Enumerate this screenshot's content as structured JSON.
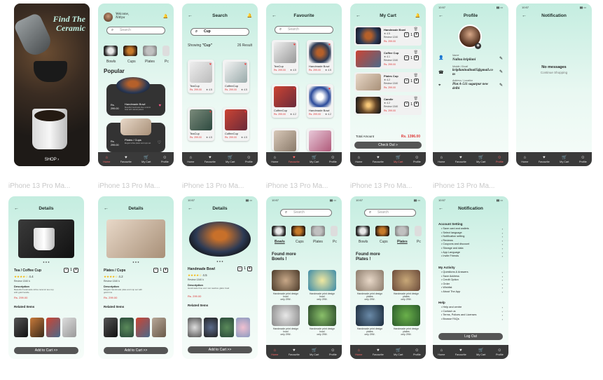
{
  "frame_label": "iPhone 13 Pro Ma...",
  "splash": {
    "title_line1": "Find The",
    "title_line2": "Ceramic",
    "cta": "SHOP"
  },
  "home": {
    "welcome": "Welcome,",
    "user": "Nithya",
    "search_placeholder": "Search",
    "section": "Popular",
    "cat1": "Bowls",
    "cat2": "Cups",
    "cat3": "Plates",
    "cat4": "Pc",
    "card1": {
      "price": "Rs. 299.00",
      "name": "Handmade Bowl",
      "desc": "Beautiful handmade blue ceramic bowl with natural pattern"
    },
    "card2": {
      "price": "Rs. 299.00",
      "name": "Plates / Cups",
      "desc": "Elegant white plates and cups set"
    }
  },
  "nav": {
    "home": "Home",
    "favourite": "Favourite",
    "cart": "My Cart",
    "profile": "Profile"
  },
  "search_screen": {
    "title": "Search",
    "query": "Cup",
    "showing": "Showing",
    "showing_q": "\"Cup\"",
    "results": "26 Result",
    "items": [
      {
        "name": "TeaCup",
        "price": "Rs. 299.00",
        "rating": "4.5"
      },
      {
        "name": "CoffeeCup",
        "price": "Rs. 299.00",
        "rating": "4.5"
      },
      {
        "name": "TeaCup",
        "price": "Rs. 299.00",
        "rating": "4.5"
      },
      {
        "name": "CoffeeCup",
        "price": "Rs. 299.00",
        "rating": "4.5"
      }
    ]
  },
  "favourite": {
    "title": "Favourite",
    "search_placeholder": "Search",
    "items": [
      {
        "name": "TeaCup",
        "price": "Rs. 299.00",
        "rating": "4.5"
      },
      {
        "name": "Handmade Bowl",
        "price": "Rs. 299.00",
        "rating": "4.5"
      },
      {
        "name": "CoffeeCup",
        "price": "Rs. 299.00",
        "rating": "4.2"
      },
      {
        "name": "Handmade Bowl",
        "price": "Rs. 299.00",
        "rating": "4.2"
      }
    ]
  },
  "cart": {
    "title": "My Cart",
    "items": [
      {
        "name": "Handmade Bowl",
        "rating": "4.5",
        "reviews": "Review 1240",
        "price": "Rs. 299.00",
        "qty": "1"
      },
      {
        "name": "Coffee Cup",
        "rating": "4.1",
        "reviews": "Review 1340",
        "price": "Rs. 299.00",
        "qty": "1"
      },
      {
        "name": "Plates Cup",
        "rating": "4.2",
        "reviews": "Review 1340",
        "price": "Rs. 299.00",
        "qty": "1"
      },
      {
        "name": "Candle",
        "rating": "4.2",
        "reviews": "Review 1340",
        "price": "Rs. 299.00",
        "qty": "1"
      }
    ],
    "total_label": "Total Amount",
    "total": "Rs. 1396.00",
    "checkout": "Check Out"
  },
  "profile": {
    "title": "Profile",
    "time": "10:57",
    "name_label": "Name",
    "name": "Nalina kripilani",
    "contact_label": "Mobile / Email",
    "contact": "kripilaninalina05@gmail.com",
    "address_label": "Address / Location",
    "address": "Plot A-511 sagarpur new delhi"
  },
  "notification": {
    "title": "Notification",
    "time": "10:57",
    "empty": "No messages",
    "link": "Continue Shopping"
  },
  "details1": {
    "title": "Details",
    "name": "Tea / Coffee Cup",
    "rating": "4.4",
    "review": "Review 1340 k",
    "desc_label": "Description",
    "desc": "Beautiful handmade white ceramic tea cup with gold handle",
    "price": "Rs. 299.00",
    "related": "Related Items",
    "qty": "1",
    "cta": "Add to Cart  >>"
  },
  "details2": {
    "title": "Details",
    "name": "Plates / Cups",
    "rating": "4.2",
    "review": "Review 1340 k",
    "desc_label": "Description",
    "desc": "Elegant handmade plate and cup set with gold rims",
    "price": "Rs. 299.00",
    "related": "Related Items",
    "qty": "1",
    "cta": "Add to Cart  >>"
  },
  "details3": {
    "title": "Details",
    "time": "10:57",
    "name": "Handmade Bowl",
    "rating": "4.5",
    "review": "Review 1340 k",
    "desc_label": "Description",
    "desc": "Handmade blue and rust reactive glaze bowl",
    "price": "Rs. 299.00",
    "related": "Related Items",
    "qty": "1",
    "cta": "Add to Cart  >>"
  },
  "category_bowls": {
    "time": "10:57",
    "search_placeholder": "Search",
    "cats": [
      "Bowls",
      "Cups",
      "Plates",
      "Pc"
    ],
    "heading1": "Found more",
    "heading2": "Bowls !",
    "items": [
      {
        "name": "Handmade print design bowl",
        "price": "only 299/-"
      },
      {
        "name": "Handmade print design bowl",
        "price": "only 299/-"
      },
      {
        "name": "Handmade print design bowl",
        "price": "only 299/-"
      },
      {
        "name": "Handmade print design bowl",
        "price": "only 299/-"
      }
    ]
  },
  "category_plates": {
    "time": "10:57",
    "search_placeholder": "Search",
    "cats": [
      "Bowls",
      "Cups",
      "Plates",
      "Pc"
    ],
    "heading1": "Found more",
    "heading2": "Plates !",
    "items": [
      {
        "name": "Handmade print design plates",
        "price": "only 299/-"
      },
      {
        "name": "Handmade print design plates",
        "price": "only 299/-"
      },
      {
        "name": "Handmade print design plates",
        "price": "only 299/-"
      },
      {
        "name": "Handmade print design plates",
        "price": "only 299/-"
      }
    ]
  },
  "settings": {
    "title": "Notification",
    "time": "10:57",
    "account_label": "Account Setting",
    "account": [
      "Save card and wallets",
      "Select language",
      "Notification setting",
      "Reviews",
      "Coupons and discount",
      "Storage and data",
      "App Language",
      "Invite Friends"
    ],
    "activity_label": "My Activity",
    "activity": [
      "Questions & Answers",
      "Save Address",
      "Credit Option",
      "Order",
      "Wishlist",
      "About The App"
    ],
    "help_label": "Help",
    "help": [
      "Help and centre",
      "Contact us",
      "Terms, Polices and Licenses",
      "Browse FAQs"
    ],
    "logout": "Log Out"
  },
  "colors": {
    "mint": "#c4ede0",
    "dark": "#3a3a3a",
    "price": "#d33333",
    "accent": "#ff6a6a"
  }
}
